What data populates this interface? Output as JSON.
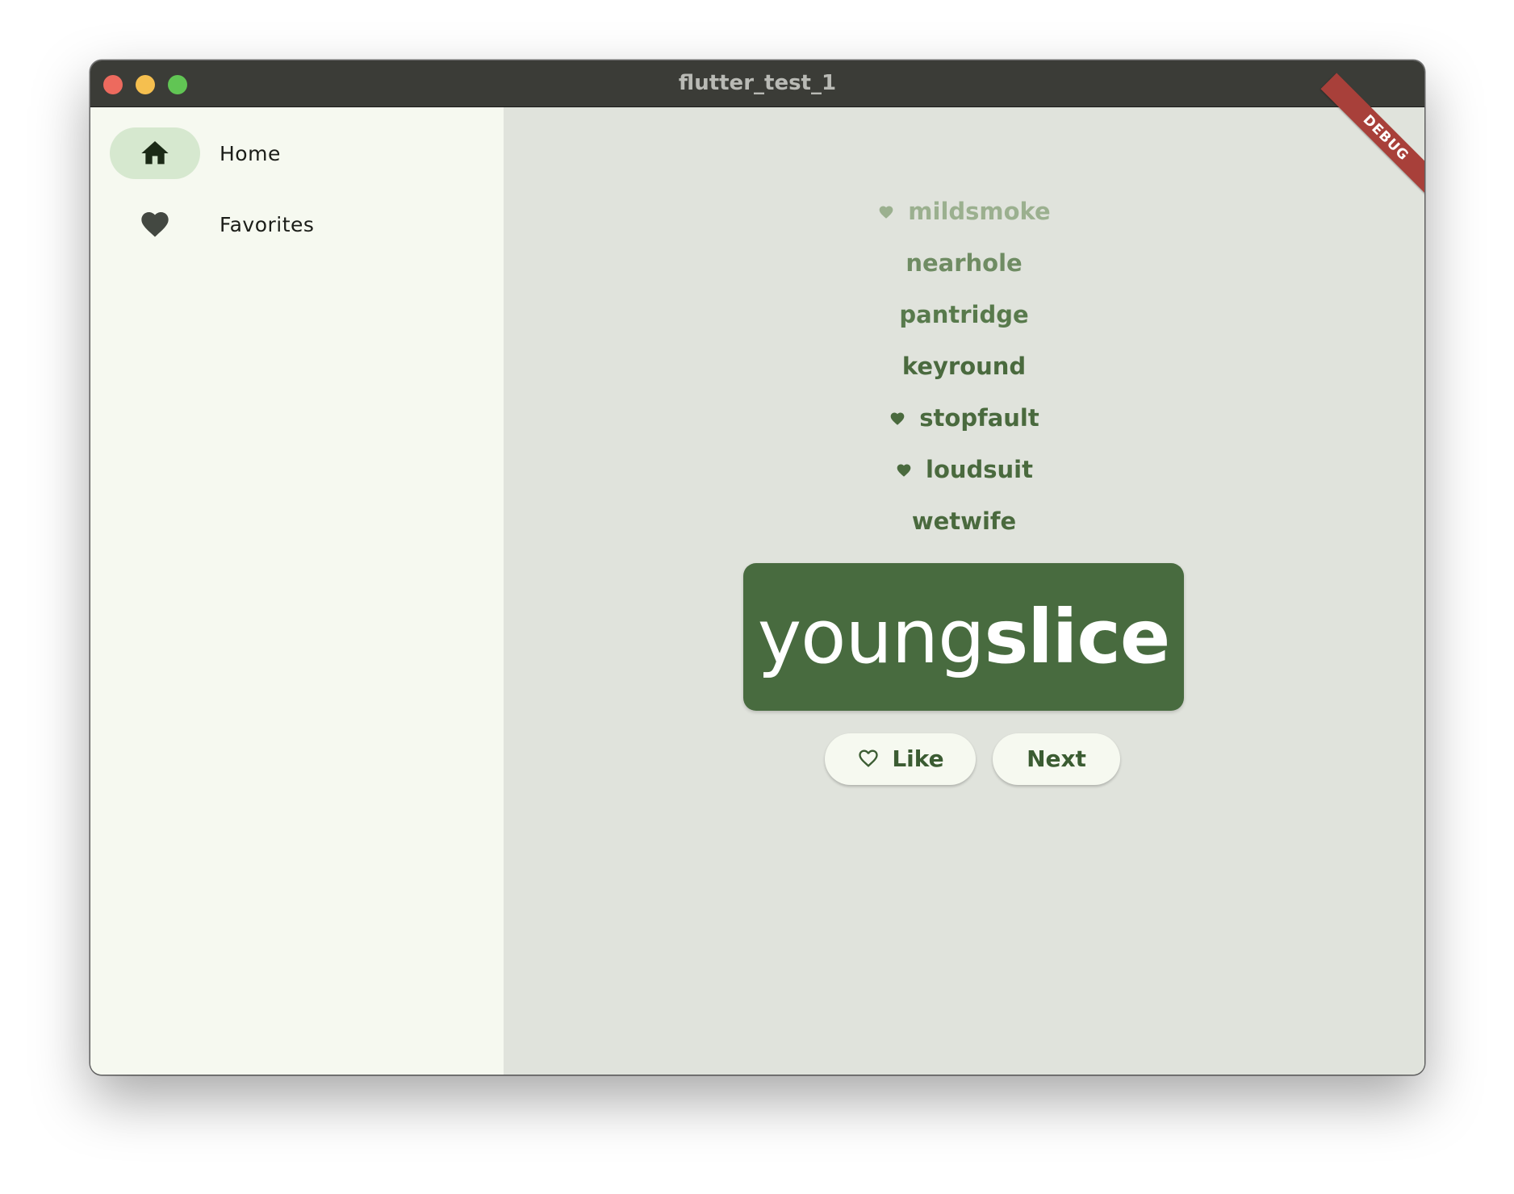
{
  "window": {
    "title": "flutter_test_1"
  },
  "sidebar": {
    "items": [
      {
        "label": "Home",
        "icon": "home-icon",
        "selected": true
      },
      {
        "label": "Favorites",
        "icon": "heart-icon",
        "selected": false
      }
    ]
  },
  "history": [
    {
      "word": "mildsmoke",
      "favorite": true
    },
    {
      "word": "nearhole",
      "favorite": false
    },
    {
      "word": "pantridge",
      "favorite": false
    },
    {
      "word": "keyround",
      "favorite": false
    },
    {
      "word": "stopfault",
      "favorite": true
    },
    {
      "word": "loudsuit",
      "favorite": true
    },
    {
      "word": "wetwife",
      "favorite": false
    }
  ],
  "current_pair": {
    "first": "young",
    "second": "slice"
  },
  "buttons": {
    "like": "Like",
    "next": "Next"
  },
  "debug_banner": "DEBUG",
  "colors": {
    "primary": "#486b3f",
    "sidebar_bg": "#f6f9f0",
    "main_bg": "#e0e3dc",
    "indicator": "#d6e8cf",
    "debug": "#a8403a"
  }
}
